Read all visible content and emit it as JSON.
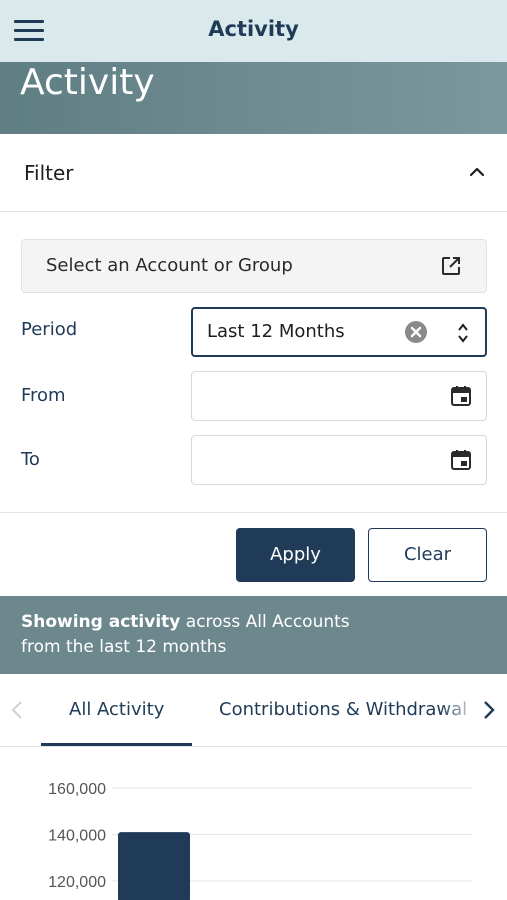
{
  "topbar": {
    "title": "Activity"
  },
  "hero": {
    "title": "Activity"
  },
  "filter": {
    "label": "Filter",
    "account_button_label": "Select an Account or Group",
    "period_label": "Period",
    "period_value": "Last 12 Months",
    "from_label": "From",
    "from_value": "",
    "to_label": "To",
    "to_value": ""
  },
  "actions": {
    "apply_label": "Apply",
    "clear_label": "Clear"
  },
  "summary": {
    "bold": "Showing activity",
    "rest": " across All Accounts",
    "line2": "from the last 12 months"
  },
  "tabs": [
    {
      "label": "All Activity",
      "active": true
    },
    {
      "label": "Contributions & Withdrawal",
      "active": false
    }
  ],
  "icons": {
    "menu": "hamburger-icon",
    "collapse": "chevron-up-icon",
    "external": "external-link-icon",
    "clear": "clear-x-icon",
    "select": "up-down-icon",
    "calendar": "calendar-icon",
    "prev": "chevron-left-icon",
    "next": "chevron-right-icon"
  },
  "colors": {
    "primary": "#1f3b57",
    "topbar": "#daeaec",
    "summary": "#6d888d"
  },
  "chart_data": {
    "type": "bar",
    "ylim": [
      110000,
      165000
    ],
    "yticks": [
      160000,
      140000,
      120000
    ],
    "tick_labels": [
      "160,000",
      "140,000",
      "120,000"
    ],
    "bars": [
      {
        "value": 141000
      }
    ]
  }
}
